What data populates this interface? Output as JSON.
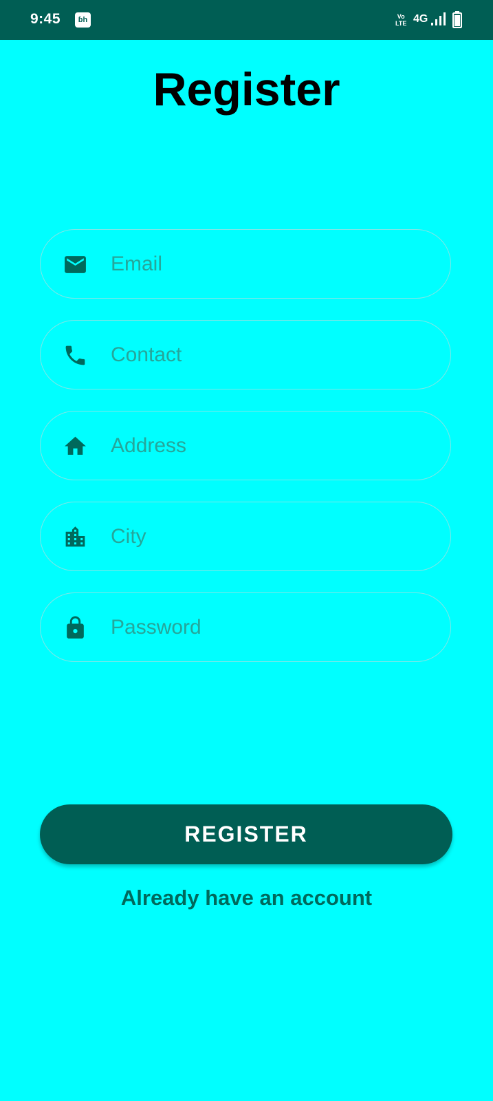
{
  "status_bar": {
    "time": "9:45",
    "app_icon_text": "ɓh",
    "volte_top": "Vo",
    "volte_bottom": "LTE",
    "network": "4G"
  },
  "page": {
    "title": "Register"
  },
  "form": {
    "fields": [
      {
        "name": "email",
        "placeholder": "Email",
        "icon": "email-icon"
      },
      {
        "name": "contact",
        "placeholder": "Contact",
        "icon": "phone-icon"
      },
      {
        "name": "address",
        "placeholder": "Address",
        "icon": "home-icon"
      },
      {
        "name": "city",
        "placeholder": "City",
        "icon": "city-icon"
      },
      {
        "name": "password",
        "placeholder": "Password",
        "icon": "lock-icon"
      }
    ],
    "register_label": "REGISTER",
    "login_link": "Already have an account"
  },
  "colors": {
    "background": "#00FFFF",
    "primary_dark": "#005E54",
    "icon": "#00695C",
    "placeholder": "#26A69A"
  }
}
